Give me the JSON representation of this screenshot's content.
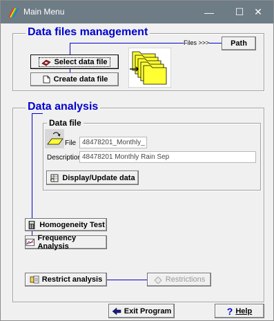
{
  "window": {
    "title": "Main Menu"
  },
  "titlebar": {
    "minimize": "—",
    "maximize": "☐",
    "close": "✕"
  },
  "data_files": {
    "heading": "Data files management",
    "files_label": "Files >>>",
    "path_button": "Path",
    "select_button": "Select data file",
    "create_button": "Create data file"
  },
  "analysis": {
    "heading": "Data analysis",
    "data_file_heading": "Data file",
    "file_label": "File",
    "file_value": "48478201_Monthly_",
    "description_label": "Description",
    "description_value": "48478201 Monthly Rain Sep",
    "display_button": "Display/Update data",
    "homogeneity_button": "Homogeneity Test",
    "frequency_button": "Frequency Analysis",
    "restrict_button": "Restrict analysis",
    "restrictions_button": "Restrictions"
  },
  "footer": {
    "exit_button": "Exit Program",
    "help_button": "Help"
  },
  "colors": {
    "heading": "#0000cc",
    "connector": "#0000cc",
    "titlebar": "#6e7c86"
  }
}
